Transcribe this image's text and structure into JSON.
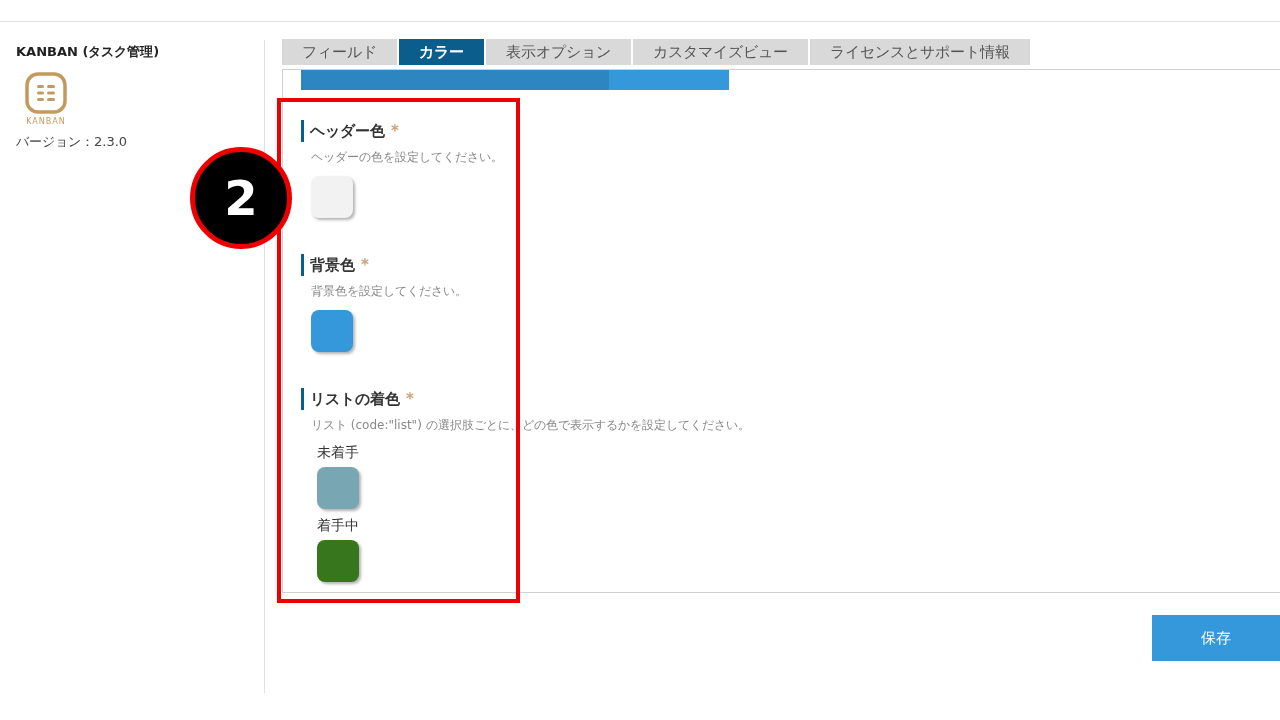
{
  "sidebar": {
    "app_name": "KANBAN (タスク管理)",
    "logo_text": "KANBAN",
    "version": "バージョン：2.3.0"
  },
  "tabs": [
    {
      "label": "フィールド",
      "selected": false
    },
    {
      "label": "カラー",
      "selected": true
    },
    {
      "label": "表示オプション",
      "selected": false
    },
    {
      "label": "カスタマイズビュー",
      "selected": false
    },
    {
      "label": "ライセンスとサポート情報",
      "selected": false
    }
  ],
  "sections": [
    {
      "kind": "single",
      "title": "ヘッダー色",
      "required_mark": "*",
      "description": "ヘッダーの色を設定してください。",
      "color": "#f2f2f2"
    },
    {
      "kind": "single",
      "title": "背景色",
      "required_mark": "*",
      "description": "背景色を設定してください。",
      "color": "#3498db"
    },
    {
      "kind": "list",
      "title": "リストの着色",
      "required_mark": "*",
      "description": "リスト (code:\"list\") の選択肢ごとに、どの色で表示するかを設定してください。",
      "items": [
        {
          "label": "未着手",
          "color": "#79a6b3"
        },
        {
          "label": "着手中",
          "color": "#38761d"
        }
      ]
    }
  ],
  "progress": {
    "level": 0.72
  },
  "annotation": {
    "step": "2"
  },
  "save_button": "保存"
}
